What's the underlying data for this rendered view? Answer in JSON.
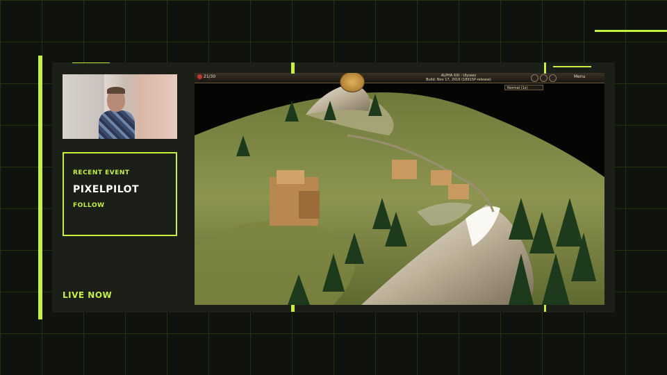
{
  "overlay": {
    "accent_color": "#c6f040",
    "recent_event_label": "RECENT EVENT",
    "streamer_name": "PIXELPILOT",
    "follow_label": "FOLLOW",
    "live_label": "LIVE NOW"
  },
  "game": {
    "population": "21/30",
    "version_title": "ALPHA XXI - Ulysses",
    "build_line": "Build: Nov 17, 2016 (18915P-release)",
    "speed_select": "Normal (1x)",
    "menu_label": "Menu",
    "icons": [
      "population-icon",
      "civ-emblem-icon",
      "clock-icon",
      "gear-icon",
      "speed-icon"
    ]
  }
}
